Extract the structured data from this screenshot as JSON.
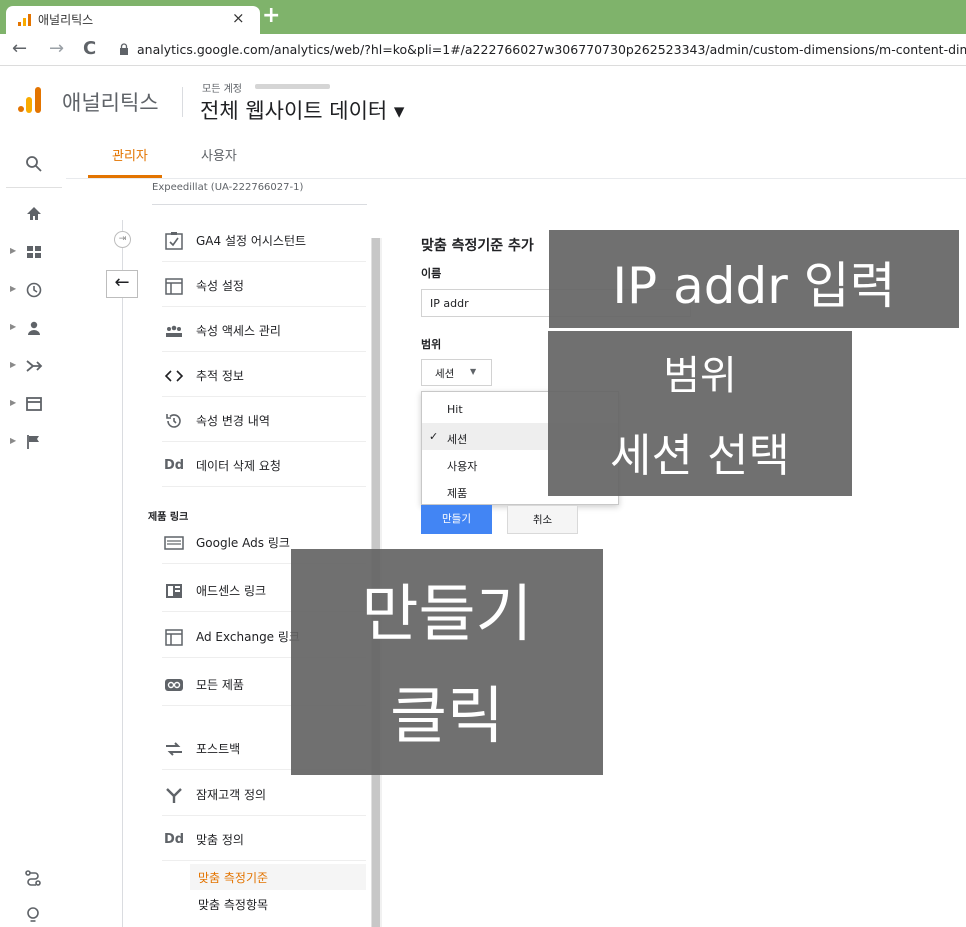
{
  "browser": {
    "tab_title": "애널리틱스",
    "tab_close": "×",
    "new_tab": "+",
    "back": "←",
    "forward": "→",
    "reload": "C",
    "url": "analytics.google.com/analytics/web/?hl=ko&pli=1#/a222766027w306770730p262523343/admin/custom-dimensions/m-content-dime"
  },
  "ga_header": {
    "product_name": "애널리틱스",
    "account_label": "모든 계정",
    "view_name": "전체 웹사이트 데이터 ▾"
  },
  "admin_tabs": [
    {
      "label": "관리자",
      "active": true
    },
    {
      "label": "사용자",
      "active": false
    }
  ],
  "property_column": {
    "header_cut": "Expeedillat (UA-222766027-1)",
    "back_arrow": "←",
    "expand_symbol": "⇥",
    "items": [
      {
        "label": "GA4 설정 어시스턴트",
        "icon": "checkbox-icon"
      },
      {
        "label": "속성 설정",
        "icon": "layout-icon"
      },
      {
        "label": "속성 액세스 관리",
        "icon": "people-icon"
      },
      {
        "label": "추적 정보",
        "icon": "code-icon"
      },
      {
        "label": "속성 변경 내역",
        "icon": "history-icon"
      },
      {
        "label": "데이터 삭제 요청",
        "icon": "dd-icon"
      }
    ],
    "section_label": "제품 링크",
    "link_items": [
      {
        "label": "Google Ads 링크",
        "icon": "ads-icon"
      },
      {
        "label": "애드센스 링크",
        "icon": "adsense-icon"
      },
      {
        "label": "Ad Exchange 링크",
        "icon": "adexchange-icon"
      },
      {
        "label": "모든 제품",
        "icon": "link-icon"
      }
    ],
    "other_items": [
      {
        "label": "포스트백",
        "icon": "postback-icon"
      },
      {
        "label": "잠재고객 정의",
        "icon": "audience-icon"
      },
      {
        "label": "맞춤 정의",
        "icon": "dd-icon"
      }
    ],
    "sub_items": [
      {
        "label": "맞춤 측정기준",
        "active": true
      },
      {
        "label": "맞춤 측정항목",
        "active": false
      }
    ],
    "dd_text": "Dd"
  },
  "form": {
    "title": "맞춤 측정기준 추가",
    "name_label": "이름",
    "name_value": "IP addr",
    "scope_label": "범위",
    "scope_value": "세션",
    "scope_options": [
      {
        "label": "Hit",
        "selected": false
      },
      {
        "label": "세션",
        "selected": true
      },
      {
        "label": "사용자",
        "selected": false
      },
      {
        "label": "제품",
        "selected": false
      }
    ],
    "check_mark": "✓",
    "create_button": "만들기",
    "cancel_button": "취소"
  },
  "annotations": {
    "ip_input": "IP addr 입력",
    "scope_line1": "범위",
    "scope_line2": "세션 선택",
    "create_line1": "만들기",
    "create_line2": "클릭"
  },
  "colors": {
    "tabbar": "#7fb36b",
    "accent": "#e37400",
    "primary_button": "#4285f4",
    "overlay": "#646464"
  }
}
